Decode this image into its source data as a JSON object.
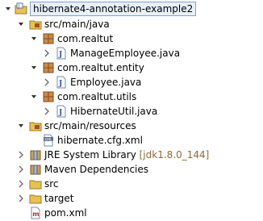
{
  "tree": {
    "root": {
      "label": "hibernate4-annotation-example2",
      "icon": "java-project-icon",
      "expanded": true,
      "selected": true
    },
    "nodes": [
      {
        "label": "src/main/java",
        "icon": "source-folder-icon",
        "expanded": true
      },
      {
        "label": "com.realtut",
        "icon": "package-icon",
        "expanded": true
      },
      {
        "label": "ManageEmployee.java",
        "icon": "java-file-icon",
        "expanded": false
      },
      {
        "label": "com.realtut.entity",
        "icon": "package-icon",
        "expanded": true
      },
      {
        "label": "Employee.java",
        "icon": "java-file-icon",
        "expanded": false
      },
      {
        "label": "com.realtut.utils",
        "icon": "package-icon",
        "expanded": true
      },
      {
        "label": "HibernateUtil.java",
        "icon": "java-file-icon",
        "expanded": false
      },
      {
        "label": "src/main/resources",
        "icon": "source-folder-icon",
        "expanded": true
      },
      {
        "label": "hibernate.cfg.xml",
        "icon": "xml-file-icon"
      },
      {
        "label": "JRE System Library",
        "annotation": "[jdk1.8.0_144]",
        "icon": "library-icon",
        "expanded": false
      },
      {
        "label": "Maven Dependencies",
        "icon": "library-icon",
        "expanded": false
      },
      {
        "label": "src",
        "icon": "folder-icon",
        "expanded": false
      },
      {
        "label": "target",
        "icon": "folder-icon",
        "expanded": false
      },
      {
        "label": "pom.xml",
        "icon": "maven-pom-icon"
      }
    ]
  },
  "colors": {
    "selection_border": "#7da2ce",
    "selection_fill": "#e8f0fb",
    "annotation_text": "#8a6a3d",
    "package_brown": "#a0522d",
    "folder_yellow": "#e8c056"
  }
}
